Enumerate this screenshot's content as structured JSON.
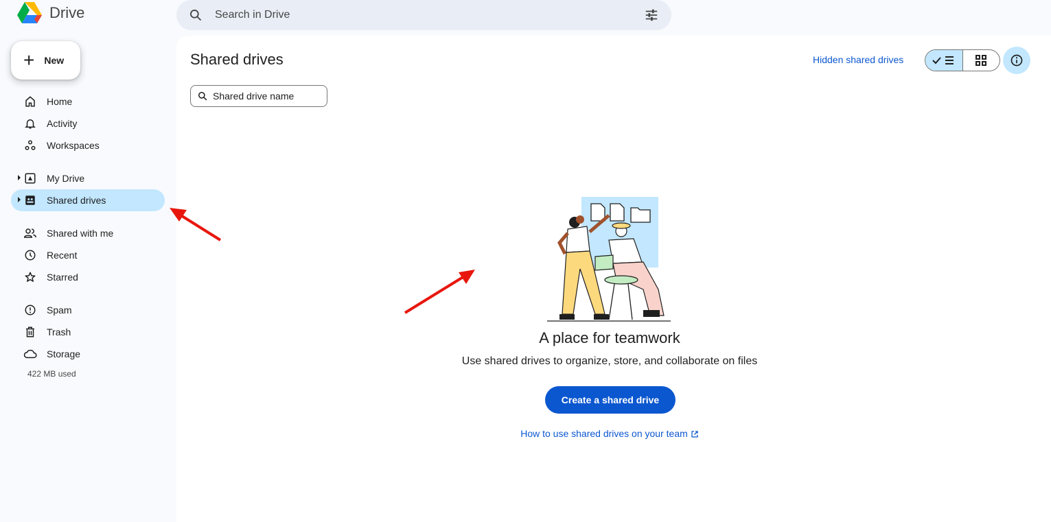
{
  "app": {
    "name": "Drive"
  },
  "search": {
    "placeholder": "Search in Drive"
  },
  "sidebar": {
    "new_label": "New",
    "items": [
      {
        "label": "Home",
        "icon": "home-icon"
      },
      {
        "label": "Activity",
        "icon": "bell-icon"
      },
      {
        "label": "Workspaces",
        "icon": "workspaces-icon"
      },
      {
        "label": "My Drive",
        "icon": "my-drive-icon"
      },
      {
        "label": "Shared drives",
        "icon": "shared-drives-icon",
        "active": true
      },
      {
        "label": "Shared with me",
        "icon": "people-icon"
      },
      {
        "label": "Recent",
        "icon": "clock-icon"
      },
      {
        "label": "Starred",
        "icon": "star-icon"
      },
      {
        "label": "Spam",
        "icon": "spam-icon"
      },
      {
        "label": "Trash",
        "icon": "trash-icon"
      },
      {
        "label": "Storage",
        "icon": "cloud-icon"
      }
    ],
    "storage_used": "422 MB used"
  },
  "main": {
    "title": "Shared drives",
    "hidden_link": "Hidden shared drives",
    "filter_placeholder": "Shared drive name",
    "empty": {
      "title": "A place for teamwork",
      "subtitle": "Use shared drives to organize, store, and collaborate on files",
      "create_button": "Create a shared drive",
      "help_link": "How to use shared drives on your team"
    }
  },
  "colors": {
    "accent": "#0b57d0",
    "active_bg": "#c2e7ff",
    "annotation_arrow": "#e8170d"
  }
}
